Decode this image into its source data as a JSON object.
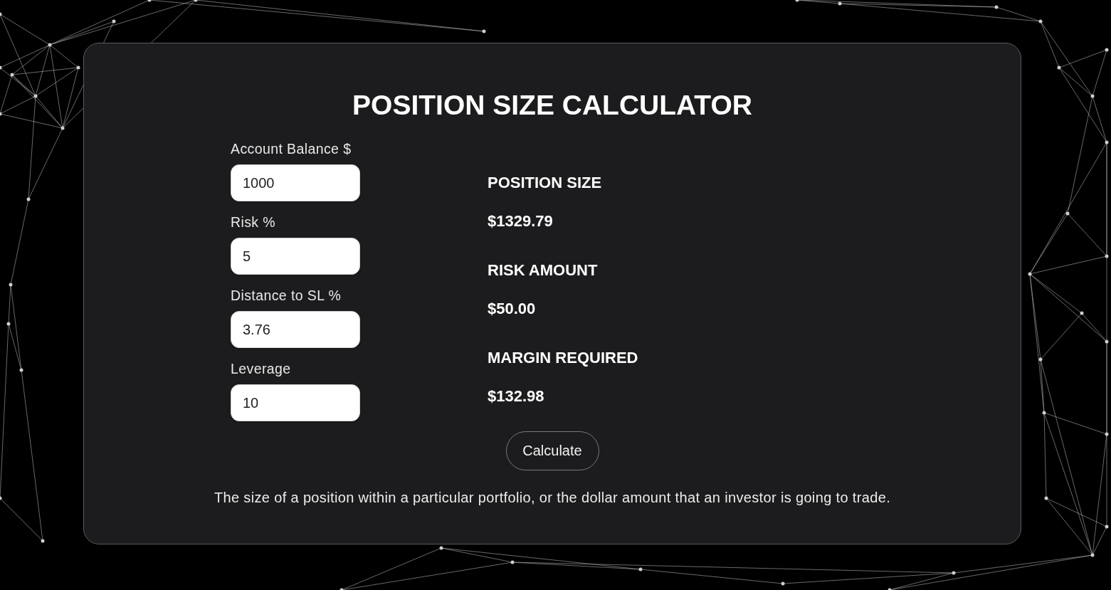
{
  "title": "POSITION SIZE CALCULATOR",
  "fields": [
    {
      "label": "Account Balance $",
      "value": "1000"
    },
    {
      "label": "Risk %",
      "value": "5"
    },
    {
      "label": "Distance to SL %",
      "value": "3.76"
    },
    {
      "label": "Leverage",
      "value": "10"
    }
  ],
  "results": [
    {
      "label": "POSITION SIZE",
      "value": "$1329.79"
    },
    {
      "label": "RISK AMOUNT",
      "value": "$50.00"
    },
    {
      "label": "MARGIN REQUIRED",
      "value": "$132.98"
    }
  ],
  "button": "Calculate",
  "description": "The size of a position within a particular portfolio, or the dollar amount that an investor is going to trade."
}
